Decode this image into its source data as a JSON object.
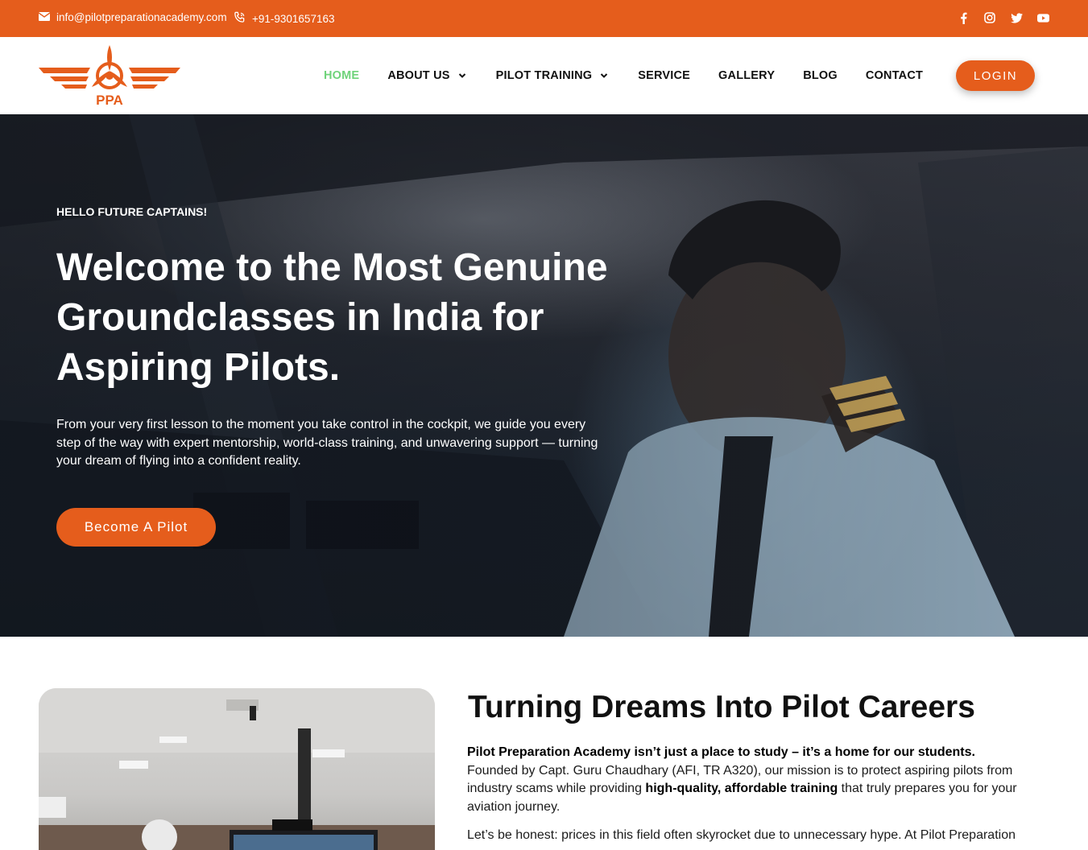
{
  "topbar": {
    "email": "info@pilotpreparationacademy.com",
    "phone": "+91-9301657163",
    "social_icons": [
      "facebook-icon",
      "instagram-icon",
      "twitter-icon",
      "youtube-icon"
    ]
  },
  "header": {
    "logo_text": "PPA",
    "nav": {
      "home": "HOME",
      "about": "ABOUT US",
      "pilot_training": "PILOT TRAINING",
      "service": "SERVICE",
      "gallery": "GALLERY",
      "blog": "BLOG",
      "contact": "CONTACT"
    },
    "login": "LOGIN"
  },
  "hero": {
    "eyebrow": "HELLO FUTURE CAPTAINS!",
    "title": "Welcome to the Most Genuine Groundclasses in India for Aspiring Pilots.",
    "description": "From your very first lesson to the moment you take control in the cockpit, we guide you every step of the way with expert mentorship, world-class training, and unwavering support — turning your dream of flying into a confident reality.",
    "cta": "Become A Pilot"
  },
  "about": {
    "title": "Turning Dreams Into Pilot Careers",
    "lead_bold": "Pilot Preparation Academy isn’t just a place to study – it’s a home for our students.",
    "p1_part1": "Founded by Capt. Guru Chaudhary (AFI, TR A320), our mission is to protect aspiring pilots from industry scams while providing ",
    "p1_bold": "high-quality, affordable training",
    "p1_part2": " that truly prepares you for your aviation journey.",
    "p2": "Let’s be honest: prices in this field often skyrocket due to unnecessary hype. At Pilot Preparation"
  },
  "colors": {
    "brand_orange": "#e55d1c",
    "nav_active": "#6fd37a",
    "text_dark": "#111111"
  }
}
